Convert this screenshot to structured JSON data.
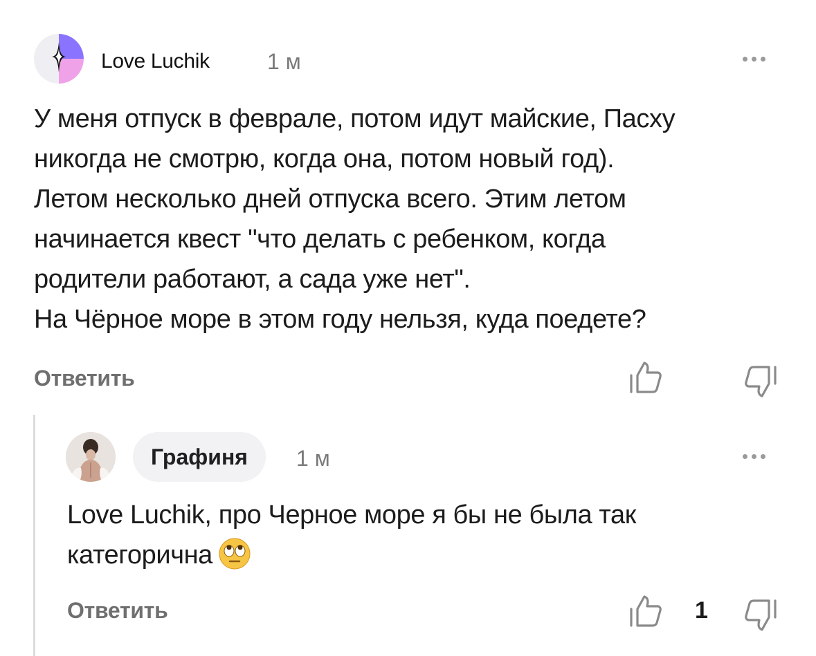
{
  "colors": {
    "text": "#1c1c1c",
    "muted": "#7a7a7a",
    "action": "#6f6f6f",
    "pill_bg": "#f2f2f4",
    "thread_line": "#dcdcdc",
    "avatar_purple": "#8a73ff",
    "avatar_pink": "#f0a2e8"
  },
  "comment": {
    "author": "Love Luchik",
    "time": "1 м",
    "avatar_icon": "sparkle-avatar-icon",
    "lines": [
      "У меня отпуск в феврале, потом идут майские, Пасху",
      "никогда не смотрю, когда она, потом новый год).",
      "Летом несколько дней отпуска всего. Этим летом",
      "начинается квест \"что делать с ребенком, когда",
      "родители работают, а сада уже нет\".",
      "На Чёрное море в этом году нельзя, куда поедете?"
    ],
    "reply_label": "Ответить",
    "like_icon": "thumbs-up-icon",
    "dislike_icon": "thumbs-down-icon"
  },
  "reply": {
    "author": "Графиня",
    "time": "1 м",
    "avatar_icon": "photo-avatar-icon",
    "lines": [
      "Love Luchik, про Черное море я бы не была так",
      "категорична"
    ],
    "emoji_icon": "face-with-rolling-eyes-icon",
    "reply_label": "Ответить",
    "likes": "1",
    "like_icon": "thumbs-up-icon",
    "dislike_icon": "thumbs-down-icon"
  }
}
